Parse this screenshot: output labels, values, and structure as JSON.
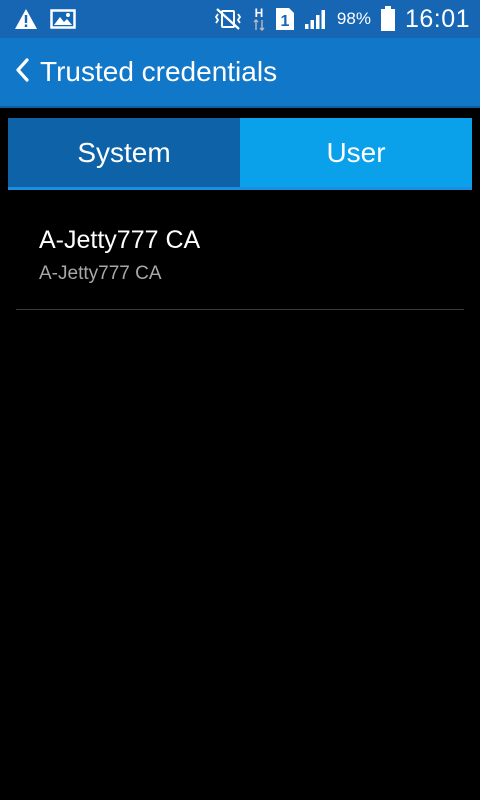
{
  "status_bar": {
    "icons_left": [
      "warning-icon",
      "image-icon"
    ],
    "icons_right": [
      "mute-vibrate-icon",
      "data-h-icon",
      "sim-1-icon",
      "signal-icon",
      "battery-icon"
    ],
    "battery_percent": "98%",
    "time": "16:01",
    "colors": {
      "background": "#1666b3"
    }
  },
  "action_bar": {
    "back_icon": "chevron-left-icon",
    "title": "Trusted credentials",
    "colors": {
      "background": "#1177c9"
    }
  },
  "tabs": [
    {
      "label": "System",
      "selected": false
    },
    {
      "label": "User",
      "selected": true
    }
  ],
  "tab_colors": {
    "system": "#0e62a8",
    "user": "#0aa0ea"
  },
  "credentials": [
    {
      "title": "A-Jetty777 CA",
      "subtitle": "A-Jetty777 CA"
    }
  ]
}
